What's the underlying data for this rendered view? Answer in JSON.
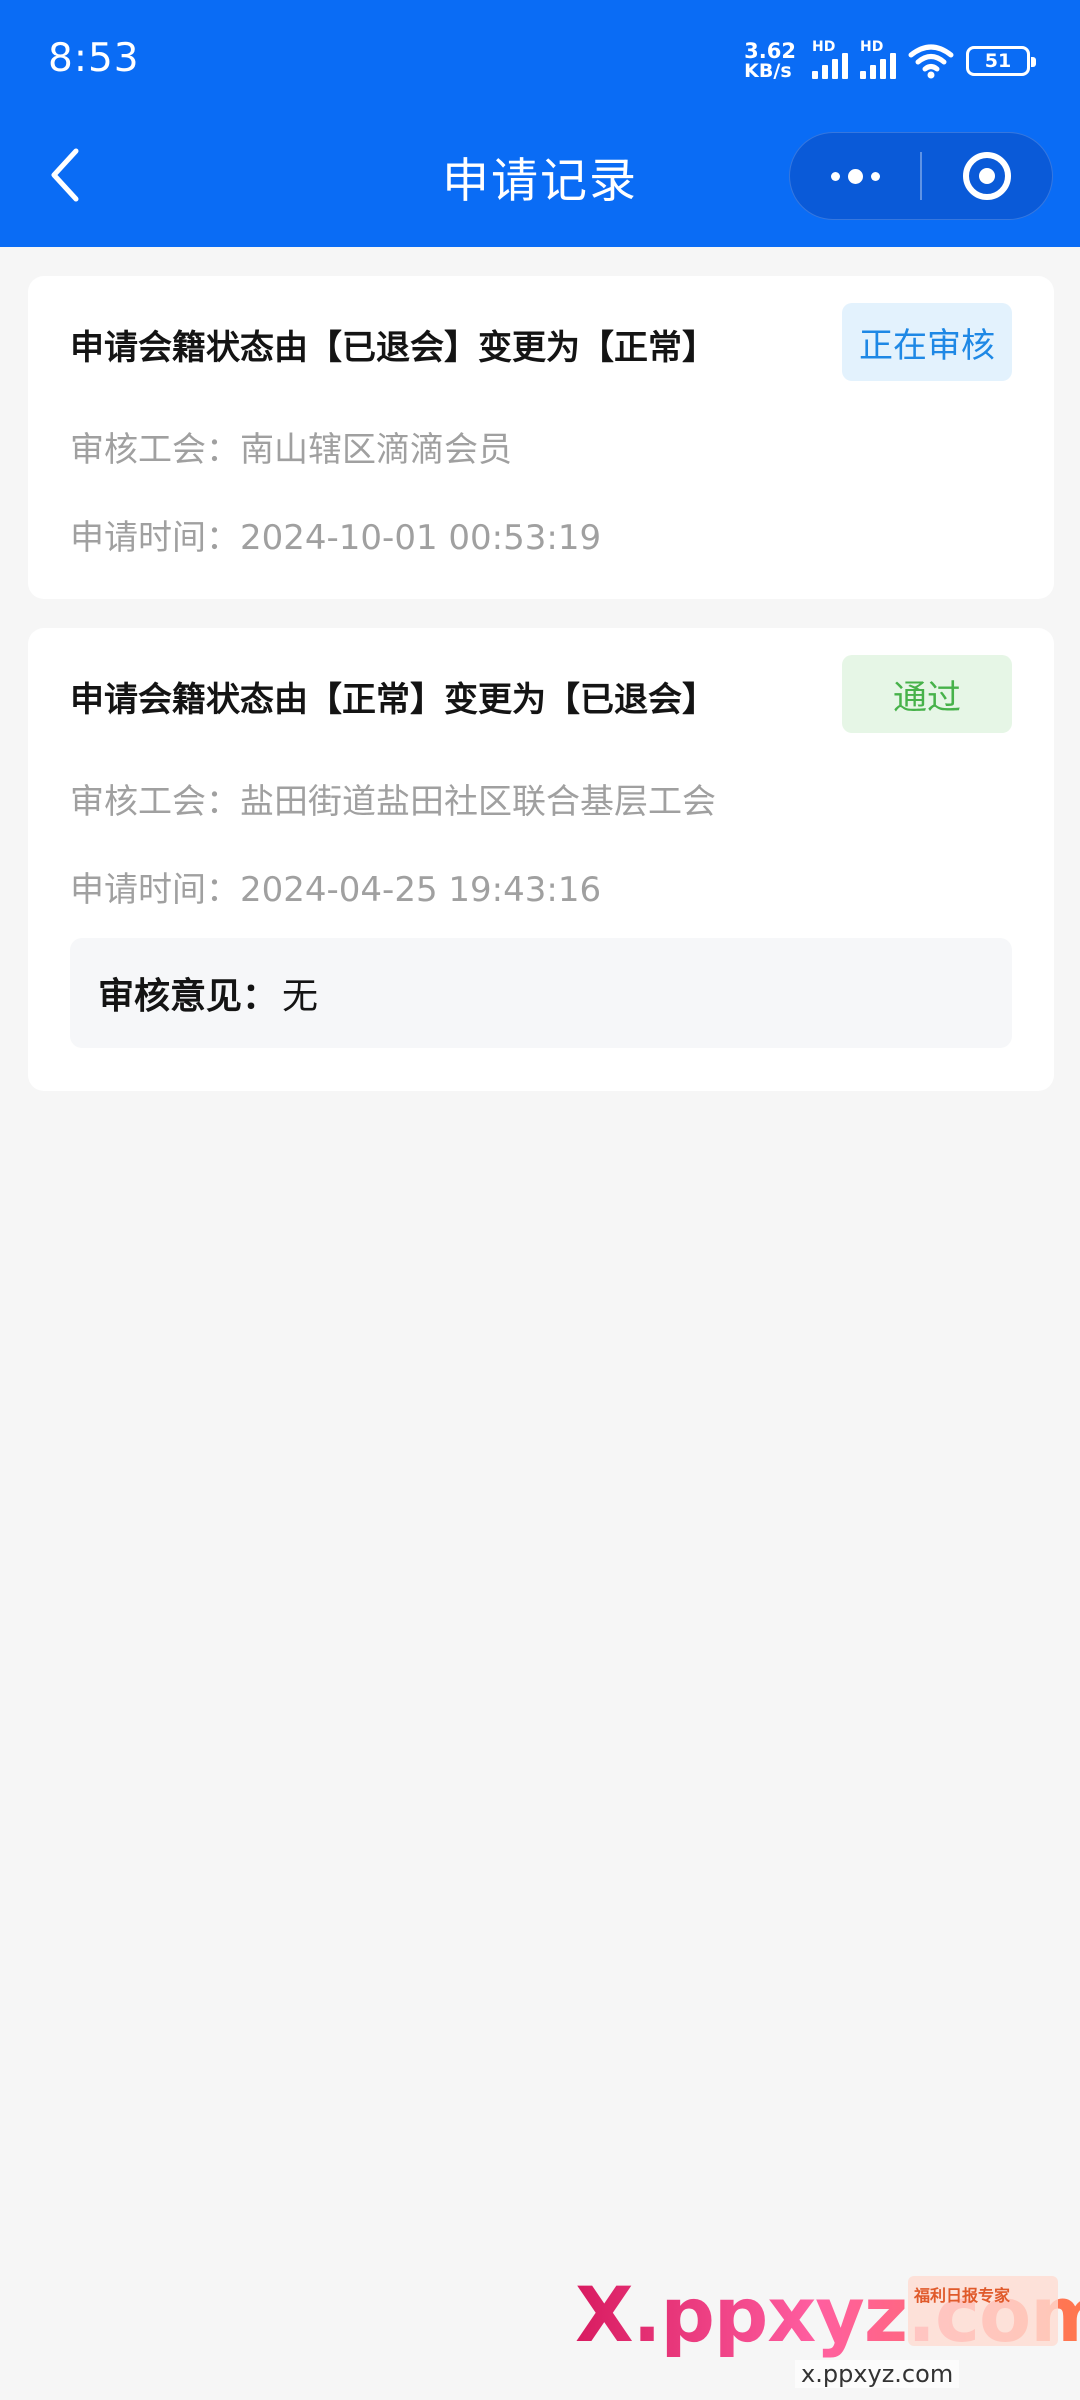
{
  "status_bar": {
    "time": "8:53",
    "net_speed_value": "3.62",
    "net_speed_unit": "KB/s",
    "signal_1_label": "HD",
    "signal_2_label": "HD",
    "battery": "51"
  },
  "nav": {
    "title": "申请记录"
  },
  "records": [
    {
      "title": "申请会籍状态由【已退会】变更为【正常】",
      "status": "正在审核",
      "union_label": "审核工会：",
      "union_value": "南山辖区滴滴会员",
      "time_label": "申请时间：",
      "time_value": "2024-10-01 00:53:19"
    },
    {
      "title": "申请会籍状态由【正常】变更为【已退会】",
      "status": "通过",
      "union_label": "审核工会：",
      "union_value": "盐田街道盐田社区联合基层工会",
      "time_label": "申请时间：",
      "time_value": "2024-04-25 19:43:16",
      "opinion_label": "审核意见：",
      "opinion_value": "无"
    }
  ],
  "watermark": {
    "logo": "X.ppxyz.com",
    "badge_text": "福利日报专家",
    "url": "x.ppxyz.com"
  },
  "colors": {
    "header_bg": "#0a6cf5",
    "reviewing_bg": "#e3f2fd",
    "reviewing_text": "#1e88e5",
    "passed_bg": "#e6f6e6",
    "passed_text": "#47b24a",
    "page_bg": "#f6f6f6"
  }
}
